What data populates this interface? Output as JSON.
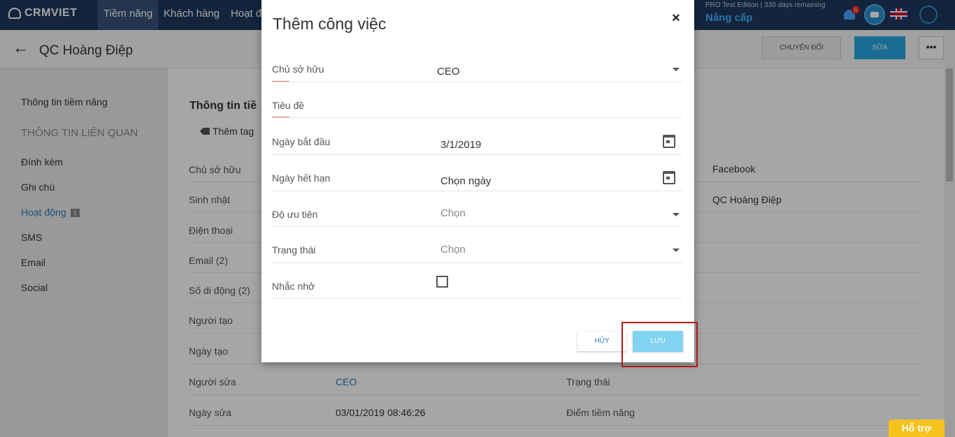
{
  "topnav": {
    "logo": "CRMVIET",
    "items": [
      "Tiềm năng",
      "Khách hàng",
      "Hoạt độ"
    ],
    "edition": "PRO Test Edition | 330 days remaining",
    "upgrade": "Nâng cấp",
    "notifications": "6"
  },
  "header": {
    "title": "QC Hoàng Điệp",
    "convert": "CHUYỂN ĐỔI",
    "edit": "SỬA",
    "more": "•••"
  },
  "sidebar": {
    "items": [
      "Thông tin tiềm năng",
      "THÔNG TIN LIÊN QUAN",
      "Đính kèm",
      "Ghi chú",
      "Hoạt động",
      "SMS",
      "Email",
      "Social"
    ],
    "activity_count": "1"
  },
  "main": {
    "section_title": "Thông tin tiề",
    "add_tag": "Thêm tag",
    "fields_left": [
      "Chủ sở hữu",
      "Sinh nhật",
      "Điện thoại",
      "Email (2)",
      "Số di động (2)",
      "Người tạo",
      "Ngày tạo",
      "Người sửa",
      "Ngày sửa"
    ],
    "modified_by": "CEO",
    "modified_at": "03/01/2019 08:46:26",
    "right_values": [
      "Facebook",
      "QC Hoàng Điệp"
    ],
    "right_labels": [
      "Trạng thái",
      "Điểm tiềm năng"
    ]
  },
  "modal": {
    "title": "Thêm công việc",
    "close": "×",
    "owner_label": "Chủ sở hữu",
    "owner_value": "CEO",
    "subject_label": "Tiêu đề",
    "start_label": "Ngày bắt đầu",
    "start_value": "3/1/2019",
    "due_label": "Ngày hết hạn",
    "due_placeholder": "Chọn ngày",
    "priority_label": "Độ ưu tiên",
    "priority_placeholder": "Chọn",
    "status_label": "Trạng thái",
    "status_placeholder": "Chọn",
    "reminder_label": "Nhắc nhở",
    "cancel": "HỦY",
    "save": "LƯU"
  },
  "support": "Hỗ trợ"
}
